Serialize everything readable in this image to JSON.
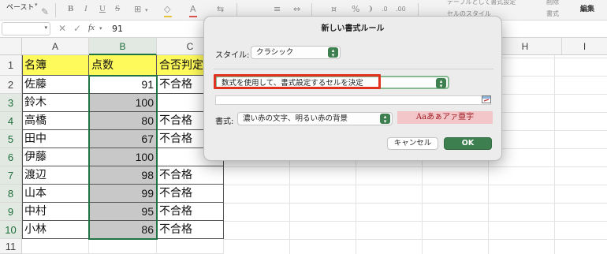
{
  "ribbon": {
    "paste_label": "ペースト",
    "bold": "B",
    "italic": "I",
    "underline": "U",
    "strike": "S",
    "font_color_letter": "A",
    "percent": "%",
    "decimal_more": ".0",
    "decimal_less": ".00",
    "table_format_label": "テーブルとして書式設定",
    "cell_style_label": "セルのスタイル",
    "delete_label": "削除",
    "format_label": "書式",
    "edit_label": "編集"
  },
  "formula_bar": {
    "name_box": "",
    "cancel_symbol": "✕",
    "accept_symbol": "✓",
    "fx_label": "fx",
    "value": "91"
  },
  "columns": [
    "A",
    "B",
    "C",
    "H",
    "I"
  ],
  "rows": [
    "1",
    "2",
    "3",
    "4",
    "5",
    "6",
    "7",
    "8",
    "9",
    "10",
    "11"
  ],
  "table": {
    "headers": [
      "名簿",
      "点数",
      "合否判定"
    ],
    "records": [
      {
        "name": "佐藤",
        "score": "91",
        "result": "不合格"
      },
      {
        "name": "鈴木",
        "score": "100",
        "result": ""
      },
      {
        "name": "高橋",
        "score": "80",
        "result": "不合格"
      },
      {
        "name": "田中",
        "score": "67",
        "result": "不合格"
      },
      {
        "name": "伊藤",
        "score": "100",
        "result": ""
      },
      {
        "name": "渡辺",
        "score": "98",
        "result": "不合格"
      },
      {
        "name": "山本",
        "score": "99",
        "result": "不合格"
      },
      {
        "name": "中村",
        "score": "95",
        "result": "不合格"
      },
      {
        "name": "小林",
        "score": "86",
        "result": "不合格"
      }
    ]
  },
  "dialog": {
    "title": "新しい書式ルール",
    "style_label": "スタイル:",
    "style_value": "クラシック",
    "rule_type_value": "数式を使用して、書式設定するセルを決定",
    "formula_value": "",
    "format_label": "書式:",
    "format_value": "濃い赤の文字、明るい赤の背景",
    "preview_text": "Aaあぁアァ亜宇",
    "cancel_button": "キャンセル",
    "ok_button": "OK"
  },
  "colors": {
    "accent_green": "#217346",
    "header_yellow": "#fffa5b",
    "highlight_red": "#e0321e",
    "preview_bg": "#f3c7c9",
    "preview_text": "#9c1a20",
    "ok_button": "#3e7f4f",
    "selected_fill": "#c8c8c8"
  }
}
